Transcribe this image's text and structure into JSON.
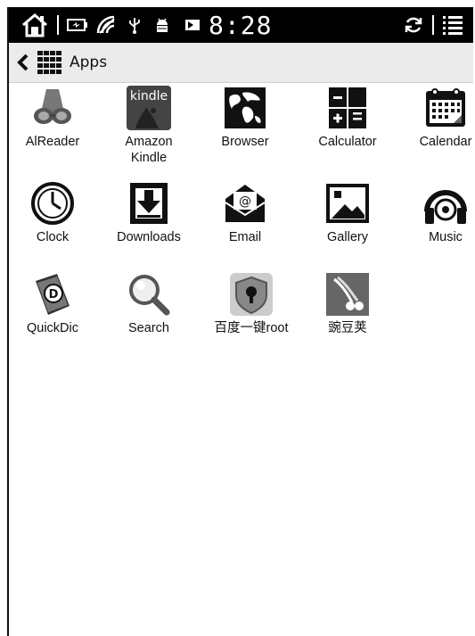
{
  "statusbar": {
    "time": "8:28",
    "icons": [
      "home-icon",
      "battery-icon",
      "wifi-icon",
      "usb-icon",
      "android-debug-icon",
      "sync-icon",
      "menu-icon"
    ]
  },
  "titlebar": {
    "title": "Apps",
    "back_icon": "chevron-left-icon",
    "grid_icon": "apps-grid-icon"
  },
  "apps": [
    {
      "label": "AlReader",
      "icon": "alreader-icon"
    },
    {
      "label": "Amazon\nKindle",
      "icon": "kindle-icon",
      "icon_text": "kindle"
    },
    {
      "label": "Browser",
      "icon": "browser-icon"
    },
    {
      "label": "Calculator",
      "icon": "calculator-icon"
    },
    {
      "label": "Calendar",
      "icon": "calendar-icon"
    },
    {
      "label": "Clock",
      "icon": "clock-icon"
    },
    {
      "label": "Downloads",
      "icon": "downloads-icon"
    },
    {
      "label": "Email",
      "icon": "email-icon"
    },
    {
      "label": "Gallery",
      "icon": "gallery-icon"
    },
    {
      "label": "Music",
      "icon": "music-icon"
    },
    {
      "label": "QuickDic",
      "icon": "quickdic-icon"
    },
    {
      "label": "Search",
      "icon": "search-icon"
    },
    {
      "label": "百度一键root",
      "icon": "baidu-root-icon"
    },
    {
      "label": "豌豆荚",
      "icon": "wandoujia-icon"
    }
  ]
}
